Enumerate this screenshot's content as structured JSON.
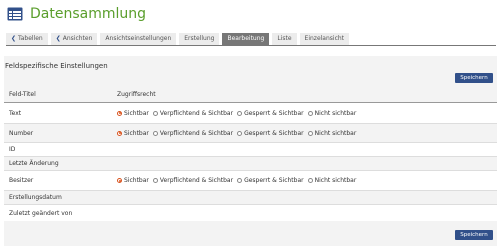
{
  "app": {
    "title": "Datensammlung",
    "icon": "table-icon"
  },
  "tabs": [
    {
      "label": "Tabellen",
      "icon": "chevron-left-icon"
    },
    {
      "label": "Ansichten",
      "icon": "chevron-left-icon"
    },
    {
      "label": "Ansichtseinstellungen"
    },
    {
      "label": "Erstellung"
    },
    {
      "label": "Bearbeitung",
      "active": true
    },
    {
      "label": "Liste"
    },
    {
      "label": "Einzelansicht"
    }
  ],
  "section": {
    "title": "Feldspezifische Einstellungen"
  },
  "buttons": {
    "save_top": "Speichern",
    "save_bottom": "Speichern"
  },
  "table": {
    "headers": {
      "field": "Feld-Titel",
      "access": "Zugriffsrecht"
    },
    "options": [
      "Sichtbar",
      "Verpflichtend & Sichtbar",
      "Gesperrt & Sichtbar",
      "Nicht sichtbar"
    ],
    "rows": [
      {
        "field": "Text",
        "has_options": true,
        "selected": "Sichtbar"
      },
      {
        "field": "Number",
        "has_options": true,
        "selected": "Sichtbar"
      },
      {
        "field": "ID",
        "has_options": false
      },
      {
        "field": "Letzte Änderung",
        "has_options": false
      },
      {
        "field": "Besitzer",
        "has_options": true,
        "selected": "Sichtbar"
      },
      {
        "field": "Erstellungsdatum",
        "has_options": false
      },
      {
        "field": "Zuletzt geändert von",
        "has_options": false
      }
    ]
  },
  "colors": {
    "title_green": "#5a9e2c",
    "button_blue": "#31508a",
    "active_tab": "#777777",
    "radio_checked": "#d9531e"
  }
}
